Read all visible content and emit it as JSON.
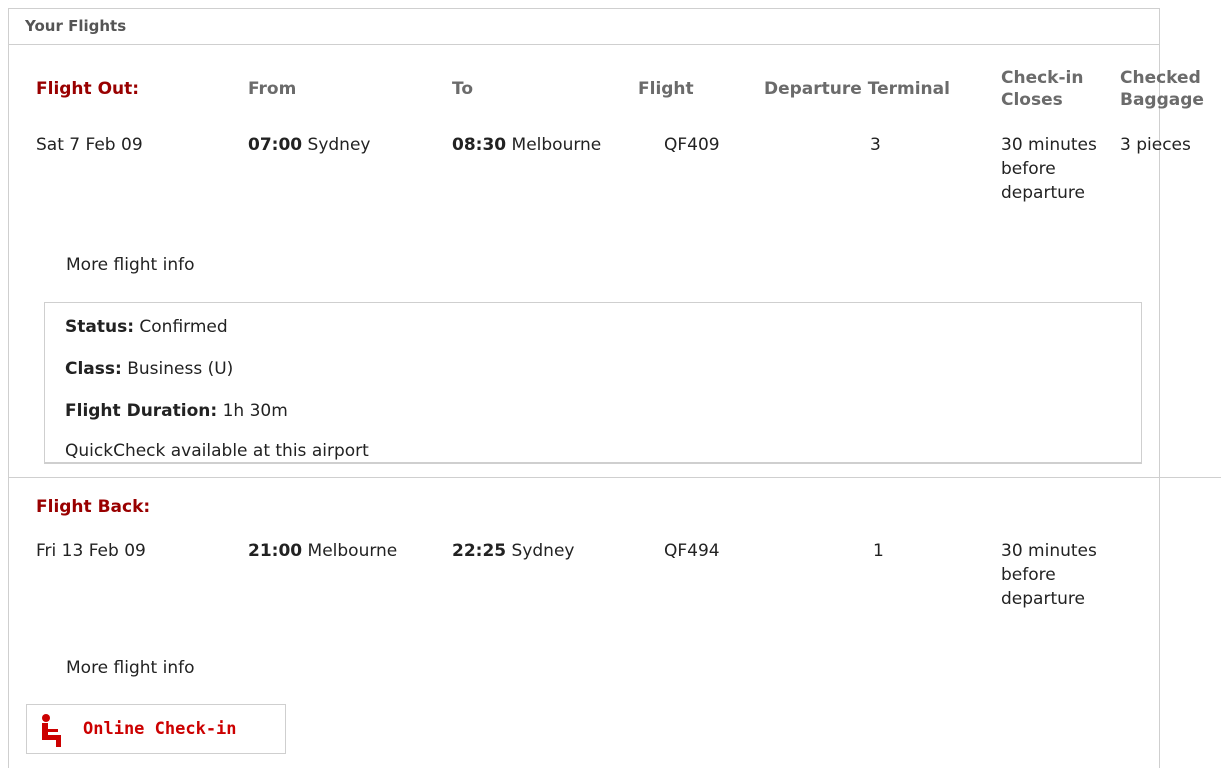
{
  "panel": {
    "title": "Your Flights"
  },
  "columns": {
    "from": "From",
    "to": "To",
    "flight": "Flight",
    "terminal": "Departure Terminal",
    "checkin_closes": "Check-in Closes",
    "checked_baggage": "Checked Baggage"
  },
  "flight_out": {
    "label": "Flight Out:",
    "date": "Sat 7 Feb 09",
    "from_time": "07:00",
    "from_city": "Sydney",
    "to_time": "08:30",
    "to_city": "Melbourne",
    "flight_no": "QF409",
    "terminal": "3",
    "checkin": "30 minutes before departure",
    "baggage": "3 pieces",
    "more_info": "More flight info",
    "details": {
      "status_label": "Status:",
      "status_value": "Confirmed",
      "class_label": "Class:",
      "class_value": "Business (U)",
      "duration_label": "Flight Duration:",
      "duration_value": "1h 30m",
      "quickcheck": "QuickCheck available at this airport"
    }
  },
  "flight_back": {
    "label": "Flight Back:",
    "date": "Fri 13 Feb 09",
    "from_time": "21:00",
    "from_city": "Melbourne",
    "to_time": "22:25",
    "to_city": "Sydney",
    "flight_no": "QF494",
    "terminal": "1",
    "checkin": "30 minutes before departure",
    "more_info": "More flight info"
  },
  "checkin_button": {
    "label": "Online Check-in",
    "icon": "seat-icon"
  },
  "colors": {
    "accent": "#990000",
    "button_text": "#cc0000",
    "header_text": "#6b6b6b",
    "border": "#cfcfcf"
  }
}
